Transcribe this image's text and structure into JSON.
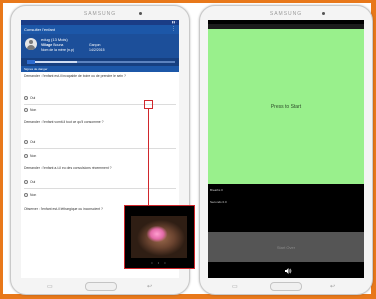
{
  "left_device": {
    "brand": "SAMSUNG",
    "appbar_title": "Consulter l'enfant",
    "patient": {
      "name": "edug (13 Mois)",
      "village_label": "Village",
      "village_value": "Bouna",
      "mother_label": "Nom de la mère (n.p)",
      "sex_value": "Garçon",
      "date_value": "14/2/2015"
    },
    "progress_fraction": 0.3,
    "section_title": "Signes de danger",
    "questions": [
      {
        "text": "Demander : l'enfant est-il incapable de boire ou de prendre le sein ?"
      },
      {
        "text": "Demander : l'enfant vomit-il tout ce qu'il consomme ?"
      },
      {
        "text": "Demander : l'enfant a-t-il eu des convulsions récemment ?"
      },
      {
        "text": "Observer : l'enfant est-il léthargique ou inconscient ?"
      }
    ],
    "option_yes": "Oui",
    "option_no": "Non"
  },
  "right_device": {
    "brand": "SAMSUNG",
    "start_text": "Press to Start",
    "info_line1": "Breaths 0",
    "info_line2": "Seconds 0.0",
    "button_text": "Start Over"
  },
  "colors": {
    "background": "#e8781a",
    "app_blue": "#1c57a8",
    "start_green": "#99f08c",
    "highlight_red": "#d0272c"
  }
}
